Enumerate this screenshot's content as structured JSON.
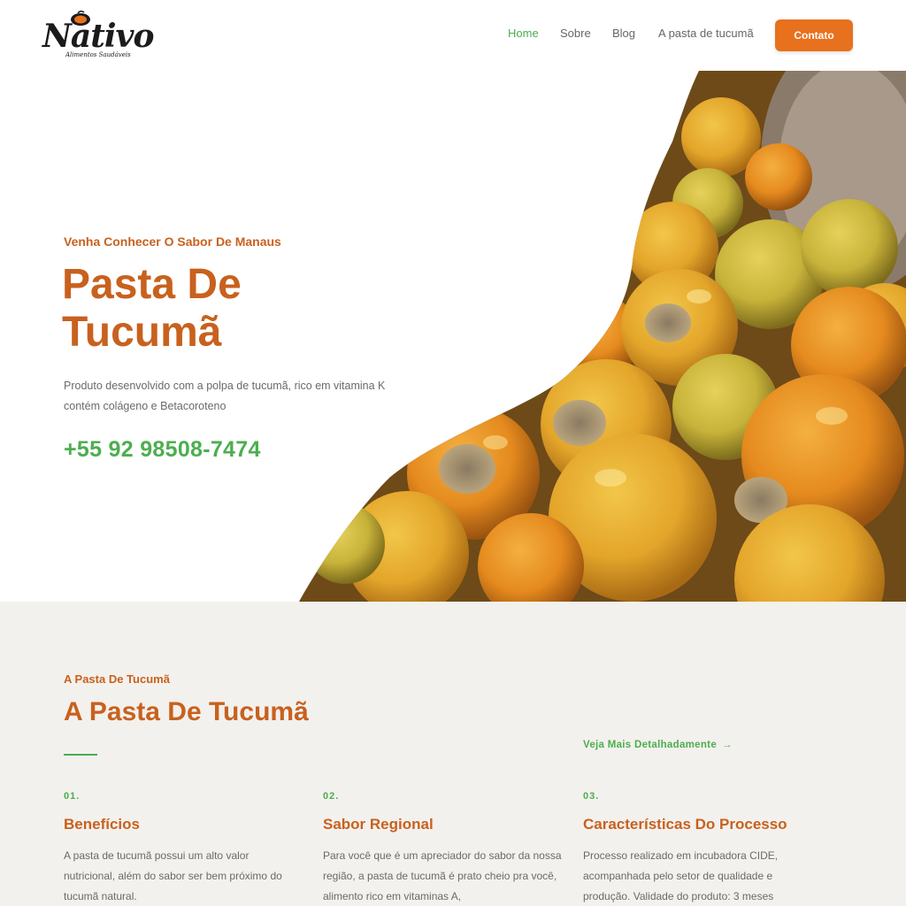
{
  "brand": {
    "logo_text": "Nativo",
    "logo_sub": "Alimentos Saudáveis"
  },
  "nav": {
    "items": [
      "Home",
      "Sobre",
      "Blog",
      "A pasta de tucumã"
    ],
    "active_index": 0,
    "cta_label": "Contato"
  },
  "hero": {
    "kicker": "Venha Conhecer O Sabor De Manaus",
    "title_line1": "Pasta De",
    "title_line2": "Tucumã",
    "description": "Produto desenvolvido com a polpa de tucumã, rico em vitamina K contém colágeno e Betacoroteno",
    "phone": "+55 92 98508-7474"
  },
  "section": {
    "kicker": "A Pasta De Tucumã",
    "title": "A Pasta De Tucumã",
    "more_link": "Veja Mais Detalhadamente",
    "columns": [
      {
        "number": "01.",
        "title": "Benefícios",
        "text": "A pasta de tucumã possui um alto valor nutricional, além do sabor ser bem próximo do tucumã natural."
      },
      {
        "number": "02.",
        "title": "Sabor Regional",
        "text": "Para você que é um apreciador do sabor da nossa região, a pasta de tucumã é prato cheio pra você, alimento rico em vitaminas A,"
      },
      {
        "number": "03.",
        "title": "Características Do Processo",
        "text": "Processo realizado em incubadora CIDE, acompanhada pelo setor de qualidade e produção. Validade do produto: 3 meses"
      }
    ]
  },
  "colors": {
    "accent_orange": "#c8611e",
    "button_orange": "#e8711e",
    "accent_green": "#4cae4f",
    "section_bg": "#f3f1ed"
  }
}
